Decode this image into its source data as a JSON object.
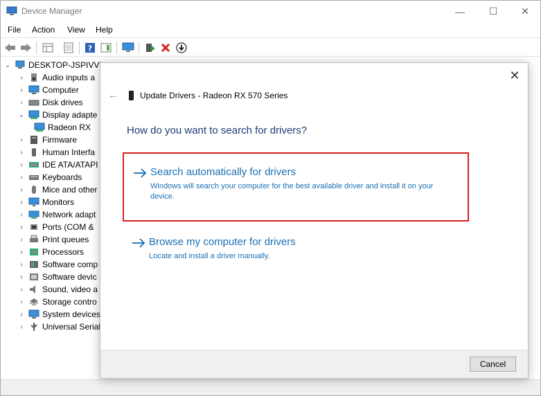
{
  "window": {
    "title": "Device Manager",
    "controls": {
      "minimize": "—",
      "maximize": "☐",
      "close": "✕"
    }
  },
  "menu": [
    "File",
    "Action",
    "View",
    "Help"
  ],
  "toolbar": {
    "buttons": [
      "back-arrow-icon",
      "forward-arrow-icon",
      "properties-grid-icon",
      "show-hidden-icon",
      "help-icon",
      "action-pane-icon",
      "monitor-scan-icon",
      "add-driver-icon",
      "uninstall-icon",
      "update-driver-icon"
    ],
    "uninstall_color": "#d42020"
  },
  "tree": {
    "root": "DESKTOP-JSPIVVN",
    "items": [
      {
        "label": "Audio inputs a",
        "icon": "audio-icon",
        "expanded": false
      },
      {
        "label": "Computer",
        "icon": "computer-icon",
        "expanded": false
      },
      {
        "label": "Disk drives",
        "icon": "disk-icon",
        "expanded": false
      },
      {
        "label": "Display adapte",
        "icon": "display-adapter-icon",
        "expanded": true
      },
      {
        "label": "Radeon RX",
        "icon": "display-adapter-icon",
        "child": true
      },
      {
        "label": "Firmware",
        "icon": "firmware-icon",
        "expanded": false
      },
      {
        "label": "Human Interfa",
        "icon": "hid-icon",
        "expanded": false
      },
      {
        "label": "IDE ATA/ATAPI",
        "icon": "ide-icon",
        "expanded": false
      },
      {
        "label": "Keyboards",
        "icon": "keyboard-icon",
        "expanded": false
      },
      {
        "label": "Mice and other",
        "icon": "mouse-icon",
        "expanded": false
      },
      {
        "label": "Monitors",
        "icon": "monitor-icon",
        "expanded": false
      },
      {
        "label": "Network adapt",
        "icon": "network-icon",
        "expanded": false
      },
      {
        "label": "Ports (COM &",
        "icon": "port-icon",
        "expanded": false
      },
      {
        "label": "Print queues",
        "icon": "printer-icon",
        "expanded": false
      },
      {
        "label": "Processors",
        "icon": "processor-icon",
        "expanded": false
      },
      {
        "label": "Software comp",
        "icon": "software-component-icon",
        "expanded": false
      },
      {
        "label": "Software devic",
        "icon": "software-device-icon",
        "expanded": false
      },
      {
        "label": "Sound, video a",
        "icon": "sound-icon",
        "expanded": false
      },
      {
        "label": "Storage contro",
        "icon": "storage-icon",
        "expanded": false
      },
      {
        "label": "System devices",
        "icon": "system-icon",
        "expanded": false
      },
      {
        "label": "Universal Serial",
        "icon": "usb-icon",
        "expanded": false
      }
    ]
  },
  "dialog": {
    "title": "Update Drivers - Radeon RX 570 Series",
    "question": "How do you want to search for drivers?",
    "options": [
      {
        "title": "Search automatically for drivers",
        "description": "Windows will search your computer for the best available driver and install it on your device."
      },
      {
        "title": "Browse my computer for drivers",
        "description": "Locate and install a driver manually."
      }
    ],
    "cancel_label": "Cancel",
    "close_glyph": "✕",
    "back_glyph": "←",
    "accent_color": "#1a6fb3",
    "highlight_color": "#d42020"
  }
}
